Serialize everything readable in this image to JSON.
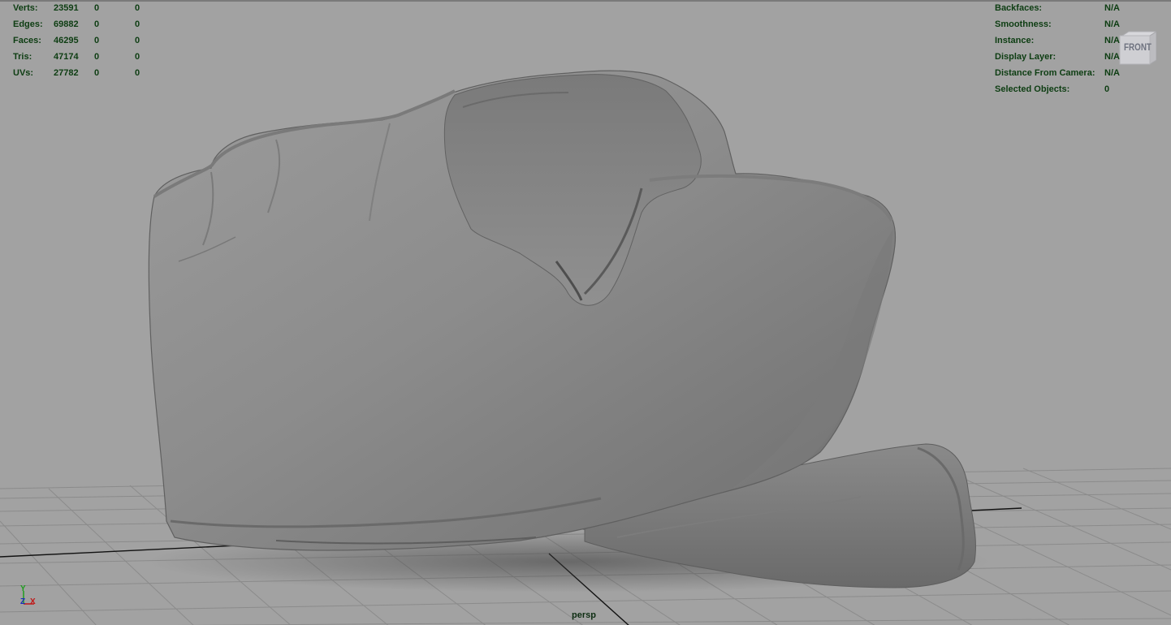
{
  "stats_left": {
    "rows": [
      {
        "label": "Verts:",
        "v1": "23591",
        "v2": "0",
        "v3": "0"
      },
      {
        "label": "Edges:",
        "v1": "69882",
        "v2": "0",
        "v3": "0"
      },
      {
        "label": "Faces:",
        "v1": "46295",
        "v2": "0",
        "v3": "0"
      },
      {
        "label": "Tris:",
        "v1": "47174",
        "v2": "0",
        "v3": "0"
      },
      {
        "label": "UVs:",
        "v1": "27782",
        "v2": "0",
        "v3": "0"
      }
    ]
  },
  "stats_right": {
    "rows": [
      {
        "label": "Backfaces:",
        "value": "N/A"
      },
      {
        "label": "Smoothness:",
        "value": "N/A"
      },
      {
        "label": "Instance:",
        "value": "N/A"
      },
      {
        "label": "Display Layer:",
        "value": "N/A"
      },
      {
        "label": "Distance From Camera:",
        "value": "N/A"
      },
      {
        "label": "Selected Objects:",
        "value": "0"
      }
    ]
  },
  "view_cube": {
    "face_label": "FRONT"
  },
  "camera": {
    "name": "persp"
  },
  "axis_gizmo": {
    "y": "Y",
    "z": "Z",
    "x": "X"
  },
  "colors": {
    "hud_text": "#0d3d12",
    "viewport_bg": "#a2a2a2",
    "grid_line": "#8a8a8a",
    "axis_line": "#000000",
    "mesh_base": "#8a8a8a"
  },
  "icons": {
    "view_cube": "view-cube-icon",
    "axis_gizmo": "axis-gizmo-icon"
  }
}
